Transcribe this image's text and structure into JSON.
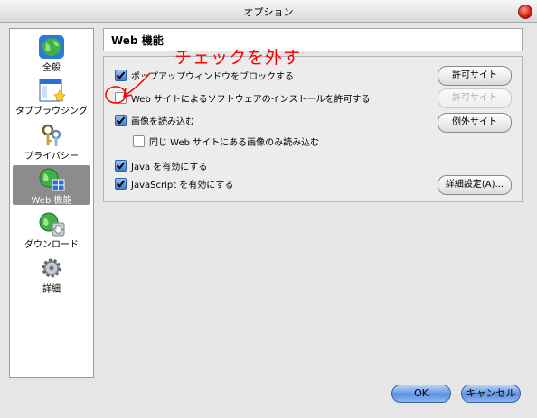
{
  "window": {
    "title": "オプション"
  },
  "sidebar": {
    "items": [
      {
        "label": "全般",
        "icon": "globe-icon"
      },
      {
        "label": "タブブラウジング",
        "icon": "tabbed-window-icon"
      },
      {
        "label": "プライバシー",
        "icon": "keys-icon"
      },
      {
        "label": "Web 機能",
        "icon": "globe-puzzle-icon",
        "selected": true
      },
      {
        "label": "ダウンロード",
        "icon": "globe-download-icon"
      },
      {
        "label": "詳細",
        "icon": "gear-icon"
      }
    ]
  },
  "header": {
    "title": "Web 機能"
  },
  "annotation": {
    "text": "チェックを外す",
    "color": "#ff0000"
  },
  "options": [
    {
      "label": "ポップアップウィンドウをブロックする",
      "checked": true
    },
    {
      "label": "Web サイトによるソフトウェアのインストールを許可する",
      "checked": false
    },
    {
      "label": "画像を読み込む",
      "checked": true
    },
    {
      "label": "同じ Web サイトにある画像のみ読み込む",
      "checked": false
    },
    {
      "label": "Java を有効にする",
      "checked": true
    },
    {
      "label": "JavaScript を有効にする",
      "checked": true
    }
  ],
  "buttons": {
    "allowed_sites_popup": "許可サイト",
    "allowed_sites_install": "許可サイト",
    "exception_sites": "例外サイト",
    "advanced": "詳細設定(A)...",
    "ok": "OK",
    "cancel": "キャンセル"
  }
}
